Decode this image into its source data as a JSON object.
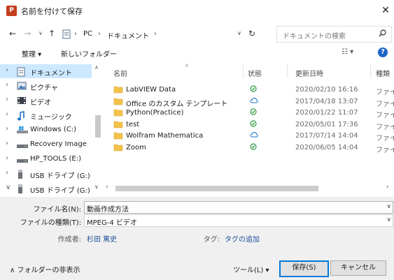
{
  "window": {
    "title": "名前を付けて保存",
    "app_icon_letter": "P",
    "close_glyph": "✕"
  },
  "address": {
    "segments": [
      "PC",
      "ドキュメント"
    ],
    "separator": "›",
    "search_placeholder": "ドキュメントの検索"
  },
  "toolbar": {
    "organize_label": "整理 ▾",
    "new_folder_label": "新しいフォルダー",
    "view_label": "☷ ▾",
    "help_glyph": "?"
  },
  "nav": {
    "items": [
      {
        "label": "ドキュメント",
        "icon": "documents-icon",
        "selected": true,
        "chevron": "›"
      },
      {
        "label": "ピクチャ",
        "icon": "pictures-icon",
        "selected": false,
        "chevron": "›"
      },
      {
        "label": "ビデオ",
        "icon": "videos-icon",
        "selected": false,
        "chevron": "›"
      },
      {
        "label": "ミュージック",
        "icon": "music-icon",
        "selected": false,
        "chevron": "›"
      },
      {
        "label": "Windows (C:)",
        "icon": "windows-drive-icon",
        "selected": false,
        "chevron": "›"
      },
      {
        "label": "Recovery Image",
        "icon": "drive-icon",
        "selected": false,
        "chevron": "›"
      },
      {
        "label": "HP_TOOLS (E:)",
        "icon": "drive-icon",
        "selected": false,
        "chevron": "›"
      },
      {
        "label": "USB ドライブ (G:)",
        "icon": "usb-drive-icon",
        "selected": false,
        "chevron": "›"
      },
      {
        "label": "USB ドライブ (G:)",
        "icon": "usb-drive-icon",
        "selected": false,
        "chevron": "∨"
      }
    ]
  },
  "files": {
    "columns": [
      "名前",
      "状態",
      "更新日時",
      "種類"
    ],
    "rows": [
      {
        "name": "LabVIEW Data",
        "status": "synced",
        "date": "2020/02/10 16:16",
        "type": "ファイ"
      },
      {
        "name": "Office のカスタム テンプレート",
        "status": "cloud",
        "date": "2017/04/18 13:07",
        "type": "ファイ"
      },
      {
        "name": "Python(Practice)",
        "status": "synced",
        "date": "2020/01/22 11:07",
        "type": "ファイ"
      },
      {
        "name": "test",
        "status": "synced",
        "date": "2020/05/01 17:36",
        "type": "ファイ"
      },
      {
        "name": "Wolfram Mathematica",
        "status": "cloud",
        "date": "2017/07/14 14:04",
        "type": "ファイ"
      },
      {
        "name": "Zoom",
        "status": "synced",
        "date": "2020/06/05 14:04",
        "type": "ファイ"
      }
    ]
  },
  "form": {
    "filename_label": "ファイル名(N):",
    "filename_value": "動画作成方法",
    "filetype_label": "ファイルの種類(T):",
    "filetype_value": "MPEG-4 ビデオ",
    "author_label": "作成者:",
    "author_value": "杉田 篤史",
    "tags_label": "タグ:",
    "tags_value": "タグの追加"
  },
  "footer": {
    "hide_folders_label": "∧  フォルダーの非表示",
    "tools_label": "ツール(L)  ▾",
    "save_label": "保存(S)",
    "cancel_label": "キャンセル"
  },
  "colors": {
    "accent": "#0078d7",
    "folder": "#f3c24a",
    "synced": "#2d9a42",
    "cloud": "#1a73c9",
    "selection": "#cce8ff"
  }
}
